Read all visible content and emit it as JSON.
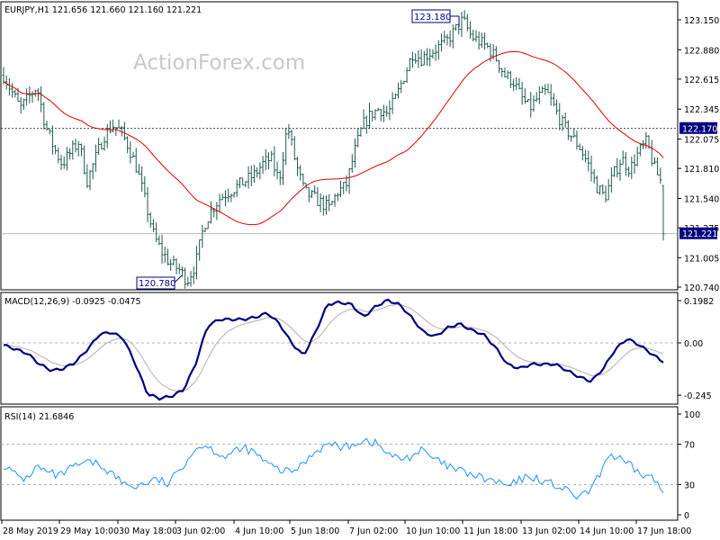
{
  "chart_data": [
    {
      "type": "bar",
      "title": "EURJPY,H1  121.656 121.660 121.160 121.221",
      "symbol": "EURJPY,H1",
      "ohlc_label": "121.656 121.660 121.160 121.221",
      "watermark": "ActionForex.com",
      "ylim": [
        120.74,
        123.3
      ],
      "y_ticks": [
        "123.150",
        "122.880",
        "122.615",
        "122.345",
        "122.075",
        "121.810",
        "121.540",
        "121.275",
        "121.005",
        "120.740"
      ],
      "h_lines": [
        {
          "value": 122.17,
          "label": "122.170",
          "style": "dashed"
        }
      ],
      "current_price": {
        "value": 121.221,
        "label": "121.221"
      },
      "annotations": [
        {
          "text": "123.180",
          "value": 123.18
        },
        {
          "text": "120.780",
          "value": 120.78
        }
      ],
      "price_path": [
        122.65,
        122.5,
        122.35,
        122.45,
        122.55,
        122.2,
        122.0,
        121.85,
        121.95,
        122.05,
        121.7,
        121.9,
        122.1,
        122.2,
        122.15,
        122.0,
        121.8,
        121.5,
        121.2,
        121.05,
        120.95,
        120.9,
        120.8,
        120.95,
        121.3,
        121.45,
        121.55,
        121.6,
        121.65,
        121.7,
        121.75,
        121.85,
        121.9,
        121.7,
        122.2,
        121.85,
        121.6,
        121.55,
        121.5,
        121.45,
        121.6,
        121.65,
        121.95,
        122.2,
        122.3,
        122.35,
        122.3,
        122.45,
        122.65,
        122.85,
        122.8,
        122.85,
        122.9,
        122.95,
        123.05,
        123.15,
        123.0,
        122.95,
        122.9,
        122.8,
        122.65,
        122.6,
        122.45,
        122.35,
        122.45,
        122.5,
        122.35,
        122.2,
        122.1,
        122.0,
        121.85,
        121.65,
        121.55,
        121.75,
        121.9,
        121.8,
        121.95,
        122.05,
        121.8,
        121.65
      ],
      "last_bar": {
        "open": 121.656,
        "high": 121.66,
        "low": 121.16,
        "close": 121.221
      },
      "ma_color": "#dd0000",
      "bar_color": "#1e5a50"
    },
    {
      "type": "line",
      "title": "MACD(12,26,9) -0.0925 -0.0475",
      "label": "MACD(12,26,9) -0.0925 -0.0475",
      "ylim": [
        -0.3,
        0.22
      ],
      "y_ticks": [
        "0.1982",
        "0.00",
        "-0.245"
      ],
      "macd_path": [
        -0.01,
        -0.03,
        -0.05,
        -0.1,
        -0.13,
        -0.12,
        -0.09,
        -0.03,
        0.04,
        0.05,
        0.02,
        -0.1,
        -0.24,
        -0.26,
        -0.25,
        -0.22,
        -0.1,
        0.08,
        0.11,
        0.11,
        0.11,
        0.12,
        0.14,
        0.09,
        0.0,
        -0.06,
        0.05,
        0.18,
        0.19,
        0.18,
        0.12,
        0.17,
        0.2,
        0.18,
        0.12,
        0.05,
        0.03,
        0.07,
        0.09,
        0.06,
        0.04,
        -0.02,
        -0.1,
        -0.12,
        -0.1,
        -0.1,
        -0.1,
        -0.13,
        -0.16,
        -0.18,
        -0.12,
        -0.03,
        0.02,
        -0.01,
        -0.05,
        -0.09
      ],
      "macd_last": -0.0925,
      "signal_last": -0.0475,
      "macd_color": "#000080",
      "signal_color": "#b0b0b0"
    },
    {
      "type": "line",
      "title": "RSI(14) 21.6846",
      "label": "RSI(14) 21.6846",
      "ylim": [
        0,
        100
      ],
      "y_ticks": [
        "100",
        "70",
        "30",
        "0"
      ],
      "levels": [
        70,
        30
      ],
      "rsi_path": [
        50,
        40,
        35,
        48,
        42,
        38,
        45,
        50,
        52,
        48,
        40,
        30,
        28,
        32,
        35,
        30,
        45,
        60,
        70,
        65,
        58,
        62,
        66,
        60,
        50,
        45,
        42,
        48,
        60,
        68,
        70,
        66,
        72,
        74,
        70,
        60,
        55,
        58,
        64,
        56,
        50,
        45,
        42,
        38,
        35,
        32,
        28,
        35,
        38,
        34,
        30,
        25,
        18,
        20,
        35,
        60,
        55,
        48,
        40,
        37,
        21.68
      ],
      "rsi_last": 21.6846,
      "line_color": "#1e90ff"
    }
  ],
  "x_axis": {
    "labels": [
      "28 May 2019",
      "29 May 10:00",
      "30 May 18:00",
      "3 Jun 02:00",
      "4 Jun 10:00",
      "5 Jun 18:00",
      "7 Jun 02:00",
      "10 Jun 10:00",
      "11 Jun 18:00",
      "13 Jun 02:00",
      "14 Jun 10:00",
      "17 Jun 18:00"
    ]
  },
  "colors": {
    "tag_fill": "#000080",
    "tag_text": "#ffffff",
    "frame": "#000000",
    "grid_dash": "#9a9a9a",
    "text": "#000000",
    "watermark": "#c8c8c8"
  }
}
